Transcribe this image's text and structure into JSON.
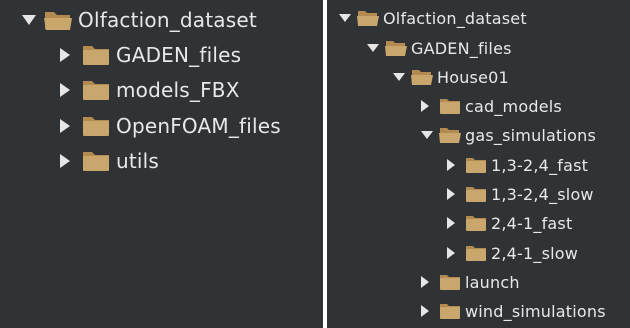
{
  "left_tree": {
    "root": {
      "label": "Olfaction_dataset",
      "expanded": true,
      "icon": "folder-open-icon"
    },
    "children": [
      {
        "label": "GADEN_files",
        "expanded": false,
        "icon": "folder-icon"
      },
      {
        "label": "models_FBX",
        "expanded": false,
        "icon": "folder-icon"
      },
      {
        "label": "OpenFOAM_files",
        "expanded": false,
        "icon": "folder-icon"
      },
      {
        "label": "utils",
        "expanded": false,
        "icon": "folder-icon"
      }
    ]
  },
  "right_tree": {
    "root": {
      "label": "Olfaction_dataset",
      "expanded": true
    },
    "gaden": {
      "label": "GADEN_files",
      "expanded": true
    },
    "house": {
      "label": "House01",
      "expanded": true
    },
    "cad": {
      "label": "cad_models",
      "expanded": false
    },
    "gas": {
      "label": "gas_simulations",
      "expanded": true
    },
    "sims": [
      {
        "label": "1,3-2,4_fast",
        "expanded": false
      },
      {
        "label": "1,3-2,4_slow",
        "expanded": false
      },
      {
        "label": "2,4-1_fast",
        "expanded": false
      },
      {
        "label": "2,4-1_slow",
        "expanded": false
      }
    ],
    "launch": {
      "label": "launch",
      "expanded": false
    },
    "wind": {
      "label": "wind_simulations",
      "expanded": false
    }
  },
  "colors": {
    "panel_bg": "#2f3336",
    "text": "#e8e8e8",
    "folder_body": "#c9a66b",
    "folder_tab": "#b38a4f",
    "arrow": "#e6e6e6"
  }
}
